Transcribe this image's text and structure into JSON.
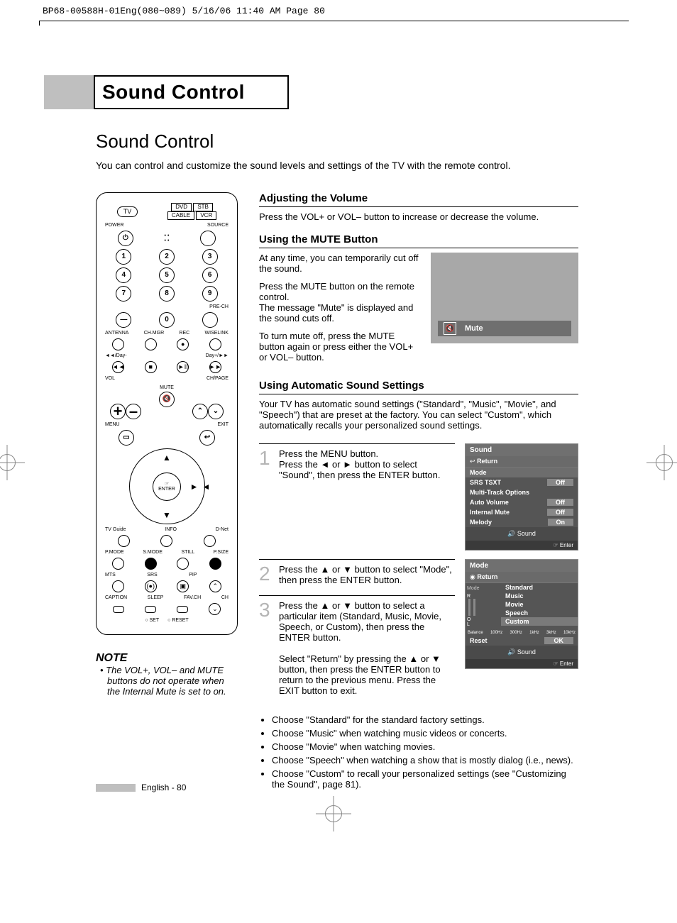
{
  "print_header": "BP68-00588H-01Eng(080~089)  5/16/06  11:40 AM  Page 80",
  "title_main": "Sound Control",
  "section_heading": "Sound Control",
  "intro": "You can control and customize the sound levels and settings of the TV with the remote control.",
  "remote": {
    "tv": "TV",
    "dvd": "DVD",
    "stb": "STB",
    "cable": "CABLE",
    "vcr": "VCR",
    "power": "POWER",
    "source": "SOURCE",
    "antenna": "ANTENNA",
    "chmgr": "CH.MGR",
    "rec": "REC",
    "wiselink": "WISELINK",
    "prech": "PRE-CH",
    "vol": "VOL",
    "chpage": "CH/PAGE",
    "mute": "MUTE",
    "menu": "MENU",
    "exit": "EXIT",
    "enter": "ENTER",
    "tvguide": "TV Guide",
    "info": "INFO",
    "dnet": "D-Net",
    "pmode": "P.MODE",
    "smode": "S.MODE",
    "still": "STILL",
    "psize": "P.SIZE",
    "mts": "MTS",
    "srs": "SRS",
    "pip": "PIP",
    "caption": "CAPTION",
    "sleep": "SLEEP",
    "favch": "FAV.CH",
    "ch": "CH",
    "set": "SET",
    "reset": "RESET",
    "dayminus": "◄◄/Day-",
    "dayplus": "Day+/►►"
  },
  "note": {
    "heading": "NOTE",
    "body": "• The VOL+, VOL– and MUTE buttons do not operate when the Internal Mute is set to on."
  },
  "adjust": {
    "heading": "Adjusting the Volume",
    "body": "Press the VOL+ or VOL– button to increase or decrease the volume."
  },
  "mute": {
    "heading": "Using the MUTE Button",
    "p1": "At any time, you can temporarily cut off the sound.",
    "p2": "Press the MUTE button on the remote control.",
    "p3": "The message \"Mute\" is displayed and the sound cuts off.",
    "p4": "To turn mute off, press the MUTE button again or press either the VOL+ or VOL– button.",
    "screen_label": "Mute"
  },
  "auto": {
    "heading": "Using Automatic Sound Settings",
    "intro": "Your TV has automatic sound settings (\"Standard\", \"Music\", \"Movie\", and \"Speech\") that are preset at the factory. You can select \"Custom\", which automatically recalls your personalized sound settings."
  },
  "steps": {
    "s1": "Press the MENU button.\nPress the ◄ or ► button to select \"Sound\", then press the ENTER button.",
    "s2": "Press the ▲ or ▼ button to select \"Mode\", then press the ENTER button.",
    "s3a": "Press the ▲ or ▼ button to select a particular item (Standard, Music, Movie, Speech, or Custom), then press the ENTER button.",
    "s3b": "Select \"Return\" by pressing the ▲ or ▼ button, then press the ENTER button to return to the previous menu. Press the EXIT button to exit."
  },
  "osd1": {
    "title": "Sound",
    "return": "Return",
    "mode": "Mode",
    "srs": "SRS TSXT",
    "srs_v": "Off",
    "mto": "Multi-Track Options",
    "av": "Auto Volume",
    "av_v": "Off",
    "im": "Internal Mute",
    "im_v": "Off",
    "mel": "Melody",
    "mel_v": "On",
    "move": "Sound",
    "enter": "Enter",
    "ret_icon": "↩"
  },
  "osd2": {
    "title": "Mode",
    "return": "Return",
    "mode": "Mode",
    "modes": [
      "Standard",
      "Music",
      "Movie",
      "Speech",
      "Custom"
    ],
    "freq": [
      "Balance",
      "100Hz",
      "300Hz",
      "1kHz",
      "3kHz",
      "10kHz"
    ],
    "reset": "Reset",
    "ok": "OK",
    "move": "Sound",
    "enter": "Enter",
    "eq_r": "R",
    "eq_o": "O",
    "eq_l": "L"
  },
  "bullets": [
    "Choose \"Standard\" for the standard factory settings.",
    "Choose \"Music\" when watching music videos or concerts.",
    "Choose \"Movie\" when watching movies.",
    "Choose \"Speech\" when watching a show that is mostly dialog (i.e., news).",
    "Choose \"Custom\" to recall your personalized settings (see \"Customizing the Sound\", page 81)."
  ],
  "footer": "English - 80"
}
